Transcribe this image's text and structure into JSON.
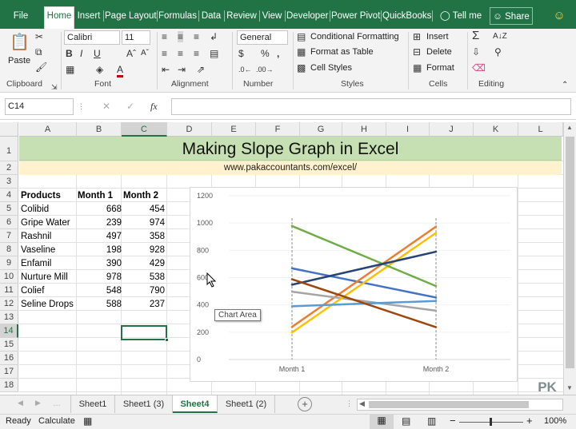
{
  "ribbon_tabs": [
    "File",
    "Home",
    "Insert",
    "Page Layout",
    "Formulas",
    "Data",
    "Review",
    "View",
    "Developer",
    "Power Pivot",
    "QuickBooks",
    "Tell me",
    "Share"
  ],
  "ribbon": {
    "paste": "Paste",
    "font_name": "Calibri",
    "font_size": "11",
    "number_format": "General",
    "conditional_formatting": "Conditional Formatting",
    "format_as_table": "Format as Table",
    "cell_styles": "Cell Styles",
    "insert": "Insert",
    "delete": "Delete",
    "format": "Format",
    "groups": [
      "Clipboard",
      "Font",
      "Alignment",
      "Number",
      "Styles",
      "Cells",
      "Editing"
    ]
  },
  "formula_bar": {
    "name_box": "C14",
    "fx": "fx",
    "formula": ""
  },
  "columns": [
    "A",
    "B",
    "C",
    "D",
    "E",
    "F",
    "G",
    "H",
    "I",
    "J",
    "K",
    "L"
  ],
  "rows": [
    "1",
    "2",
    "3",
    "4",
    "5",
    "6",
    "7",
    "8",
    "9",
    "10",
    "11",
    "12",
    "13",
    "14",
    "15",
    "16",
    "17",
    "18"
  ],
  "sheet": {
    "title": "Making Slope Graph in Excel",
    "subtitle": "www.pakaccountants.com/excel/",
    "headers": [
      "Products",
      "Month 1",
      "Month 2"
    ],
    "data": [
      [
        "Colibid",
        "668",
        "454"
      ],
      [
        "Gripe Water",
        "239",
        "974"
      ],
      [
        "Rashnil",
        "497",
        "358"
      ],
      [
        "Vaseline",
        "198",
        "928"
      ],
      [
        "Enfamil",
        "390",
        "429"
      ],
      [
        "Nurture Mill",
        "978",
        "538"
      ],
      [
        "Colief",
        "548",
        "790"
      ],
      [
        "Seline Drops",
        "588",
        "237"
      ]
    ]
  },
  "chart_data": {
    "type": "line",
    "categories": [
      "Month 1",
      "Month 2"
    ],
    "ylim": [
      0,
      1200
    ],
    "yticks": [
      "0",
      "200",
      "400",
      "600",
      "800",
      "1000",
      "1200"
    ],
    "series": [
      {
        "values": [
          668,
          454
        ],
        "color": "#4472c4"
      },
      {
        "values": [
          239,
          974
        ],
        "color": "#ed7d31"
      },
      {
        "values": [
          497,
          358
        ],
        "color": "#a5a5a5"
      },
      {
        "values": [
          198,
          928
        ],
        "color": "#ffc000"
      },
      {
        "values": [
          390,
          429
        ],
        "color": "#5b9bd5"
      },
      {
        "values": [
          978,
          538
        ],
        "color": "#70ad47"
      },
      {
        "values": [
          548,
          790
        ],
        "color": "#264478"
      },
      {
        "values": [
          588,
          237
        ],
        "color": "#9e480e"
      }
    ],
    "tooltip": "Chart Area"
  },
  "sheet_tabs": [
    "Sheet1",
    "Sheet1 (3)",
    "Sheet4",
    "Sheet1 (2)"
  ],
  "active_sheet": "Sheet4",
  "status": {
    "ready": "Ready",
    "calculate": "Calculate",
    "zoom": "100%"
  },
  "watermark": "PK a/c"
}
